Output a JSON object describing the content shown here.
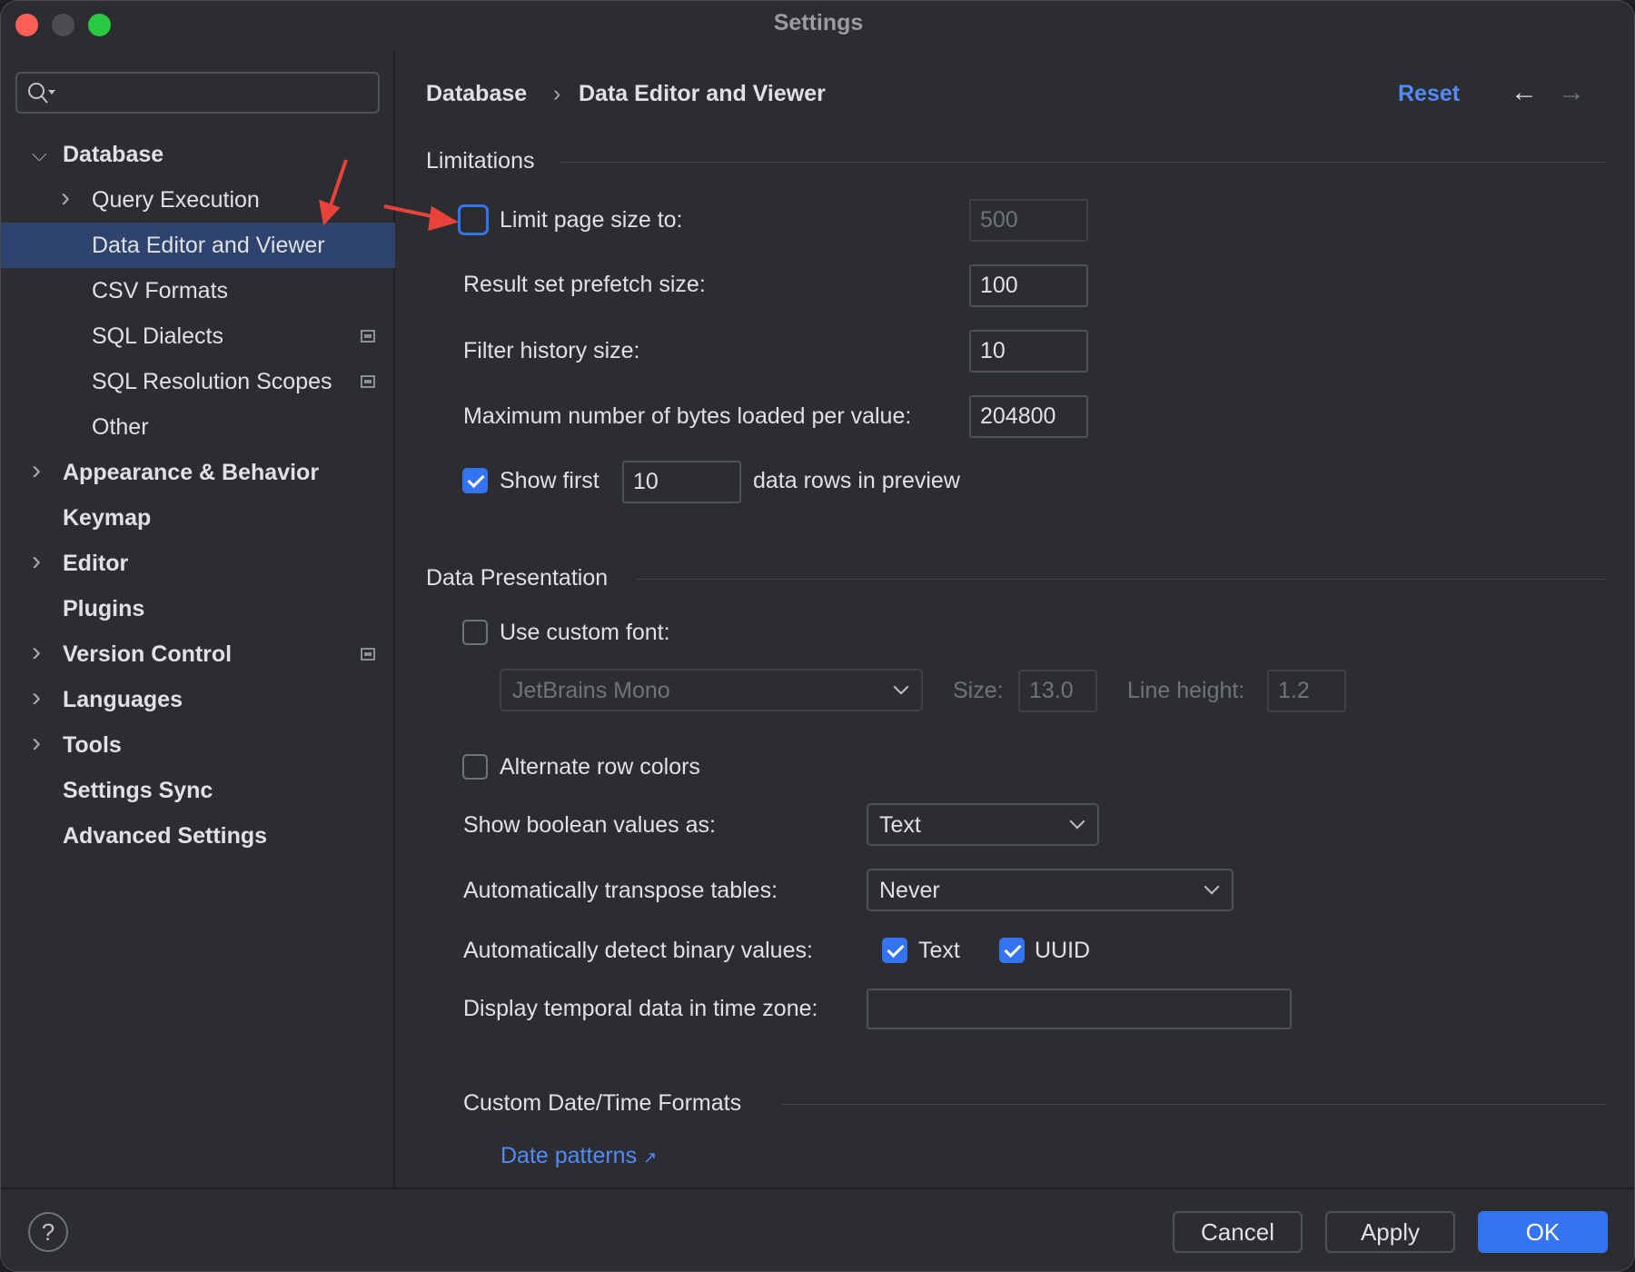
{
  "window": {
    "title": "Settings"
  },
  "colors": {
    "accent": "#3574f0",
    "selection": "#2e436e",
    "link": "#548af7",
    "annotation_arrow": "#e8423a"
  },
  "search": {
    "placeholder": "",
    "icon": "search-icon"
  },
  "sidebar": {
    "items": [
      {
        "label": "Database",
        "level": 0,
        "expanded": true,
        "bold": true
      },
      {
        "label": "Query Execution",
        "level": 1,
        "collapsed": true
      },
      {
        "label": "Data Editor and Viewer",
        "level": 1,
        "selected": true
      },
      {
        "label": "CSV Formats",
        "level": 1
      },
      {
        "label": "SQL Dialects",
        "level": 1,
        "badge": true
      },
      {
        "label": "SQL Resolution Scopes",
        "level": 1,
        "badge": true
      },
      {
        "label": "Other",
        "level": 1
      },
      {
        "label": "Appearance & Behavior",
        "level": 0,
        "collapsed": true,
        "bold": true
      },
      {
        "label": "Keymap",
        "level": 0,
        "bold": true
      },
      {
        "label": "Editor",
        "level": 0,
        "collapsed": true,
        "bold": true
      },
      {
        "label": "Plugins",
        "level": 0,
        "bold": true
      },
      {
        "label": "Version Control",
        "level": 0,
        "collapsed": true,
        "bold": true,
        "badge": true
      },
      {
        "label": "Languages",
        "level": 0,
        "collapsed": true,
        "bold": true
      },
      {
        "label": "Tools",
        "level": 0,
        "collapsed": true,
        "bold": true
      },
      {
        "label": "Settings Sync",
        "level": 0,
        "bold": true
      },
      {
        "label": "Advanced Settings",
        "level": 0,
        "bold": true
      }
    ]
  },
  "header": {
    "breadcrumb": [
      "Database",
      "Data Editor and Viewer"
    ],
    "separator": "›",
    "reset": "Reset",
    "back": "←",
    "forward": "→"
  },
  "limitations": {
    "title": "Limitations",
    "limit_page": {
      "label": "Limit page size to:",
      "checked": false,
      "value": "500"
    },
    "prefetch": {
      "label": "Result set prefetch size:",
      "value": "100"
    },
    "filter_history": {
      "label": "Filter history size:",
      "value": "10"
    },
    "max_bytes": {
      "label": "Maximum number of bytes loaded per value:",
      "value": "204800"
    },
    "show_first": {
      "label": "Show first",
      "checked": true,
      "value": "10",
      "suffix": "data rows in preview"
    }
  },
  "presentation": {
    "title": "Data Presentation",
    "custom_font": {
      "label": "Use custom font:",
      "checked": false,
      "font": "JetBrains Mono",
      "size_label": "Size:",
      "size": "13.0",
      "line_height_label": "Line height:",
      "line_height": "1.2"
    },
    "alternate": {
      "label": "Alternate row colors",
      "checked": false
    },
    "boolean": {
      "label": "Show boolean values as:",
      "value": "Text"
    },
    "transpose": {
      "label": "Automatically transpose tables:",
      "value": "Never"
    },
    "binary": {
      "label": "Automatically detect binary values:",
      "text": "Text",
      "text_checked": true,
      "uuid": "UUID",
      "uuid_checked": true
    },
    "timezone": {
      "label": "Display temporal data in time zone:",
      "value": ""
    }
  },
  "datetime": {
    "title": "Custom Date/Time Formats",
    "link": "Date patterns",
    "link_icon": "↗"
  },
  "footer": {
    "help": "?",
    "cancel": "Cancel",
    "apply": "Apply",
    "ok": "OK"
  }
}
